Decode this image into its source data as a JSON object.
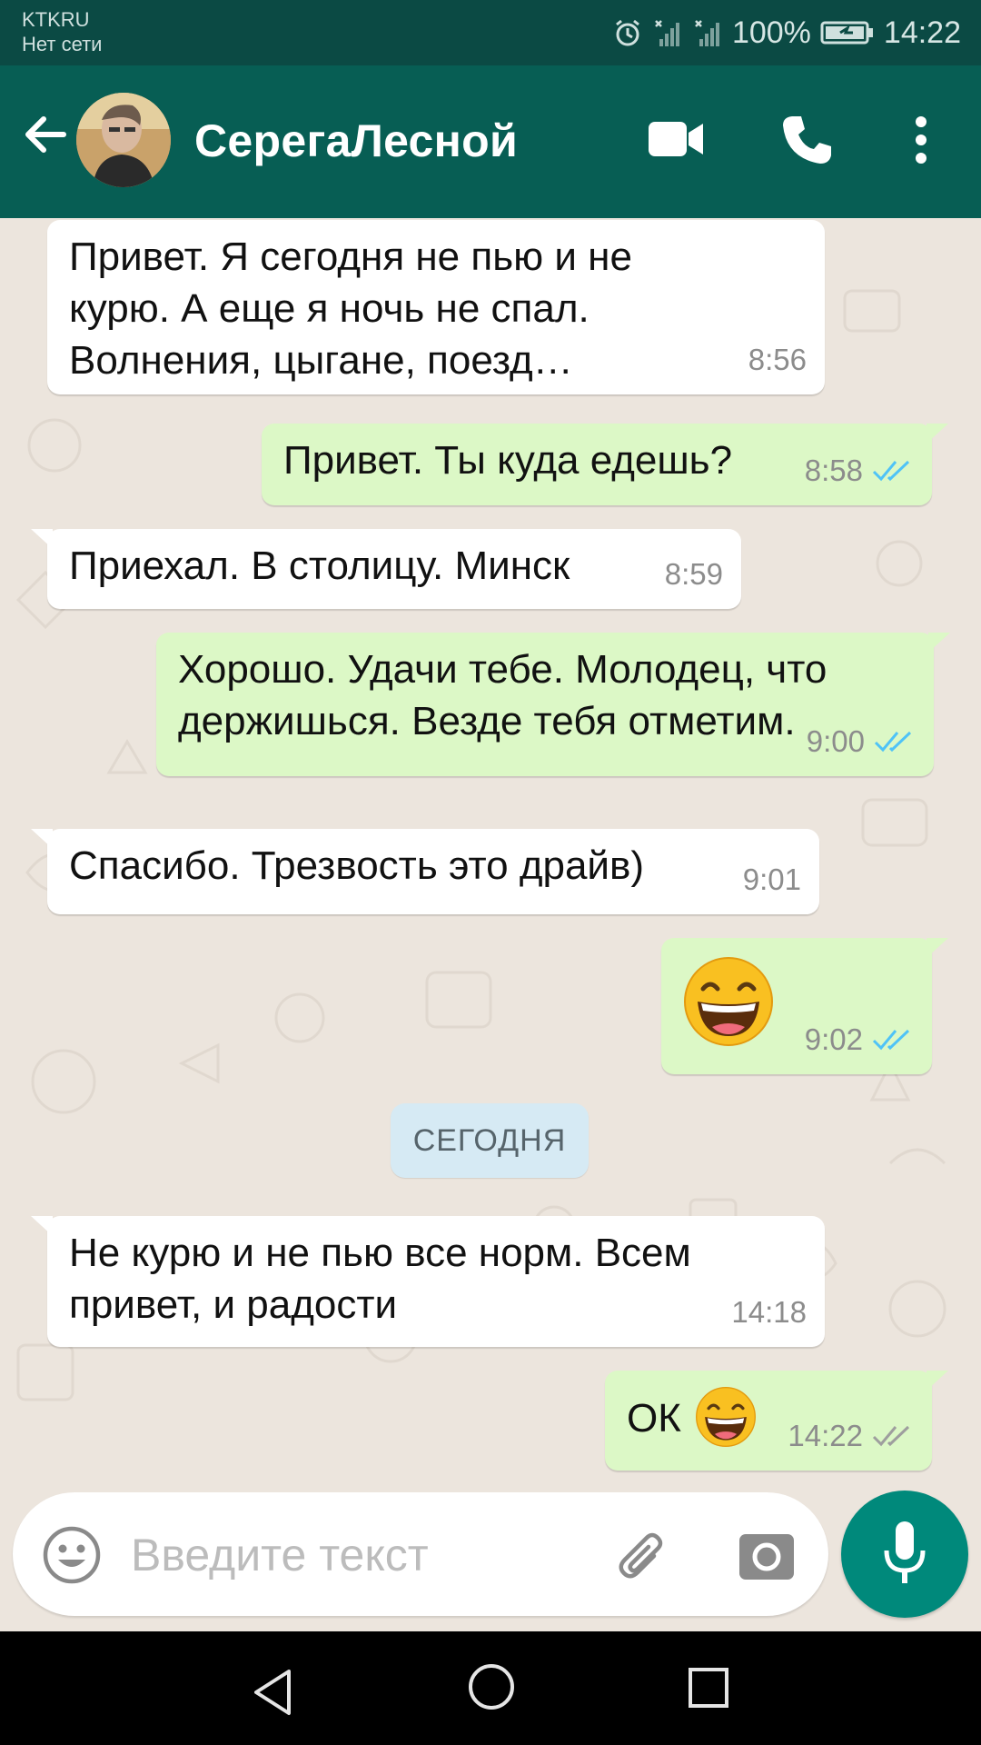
{
  "status_bar": {
    "carrier": "KTKRU",
    "network": "Нет сети",
    "battery": "100%",
    "time": "14:22"
  },
  "header": {
    "contact_name": "СерегаЛесной",
    "icons": [
      "back-arrow-icon",
      "video-call-icon",
      "phone-icon",
      "more-options-icon"
    ]
  },
  "messages": [
    {
      "direction": "in",
      "text": "Привет. Я сегодня не пью и не\nкурю. А еще я ночь не спал.\nВолнения, цыгане, поезд…",
      "time": "8:56"
    },
    {
      "direction": "out",
      "text": "Привет. Ты куда едешь?",
      "time": "8:58",
      "status": "read"
    },
    {
      "direction": "in",
      "text": "Приехал. В столицу. Минск",
      "time": "8:59"
    },
    {
      "direction": "out",
      "text": "Хорошо. Удачи тебе. Молодец, что\nдержишься. Везде тебя отметим.",
      "time": "9:00",
      "status": "read"
    },
    {
      "direction": "in",
      "text": "Спасибо. Трезвость это драйв)",
      "time": "9:01"
    },
    {
      "direction": "out",
      "text": "",
      "emoji": "grinning-face-icon",
      "time": "9:02",
      "status": "read"
    },
    {
      "direction": "in",
      "text": "Не курю и не пью все норм. Всем\nпривет, и радости",
      "time": "14:18"
    },
    {
      "direction": "out",
      "text": "ОК",
      "emoji": "grinning-face-icon",
      "time": "14:22",
      "status": "delivered"
    }
  ],
  "date_divider": "СЕГОДНЯ",
  "composer": {
    "placeholder": "Введите текст",
    "icons": [
      "emoji-icon",
      "attach-icon",
      "camera-icon",
      "mic-icon"
    ]
  },
  "colors": {
    "header": "#075e54",
    "status_bar": "#0b4a44",
    "outgoing_bubble": "#dcf8c6",
    "incoming_bubble": "#ffffff",
    "read_ticks": "#4fc3f7",
    "mic_button": "#00897b"
  }
}
